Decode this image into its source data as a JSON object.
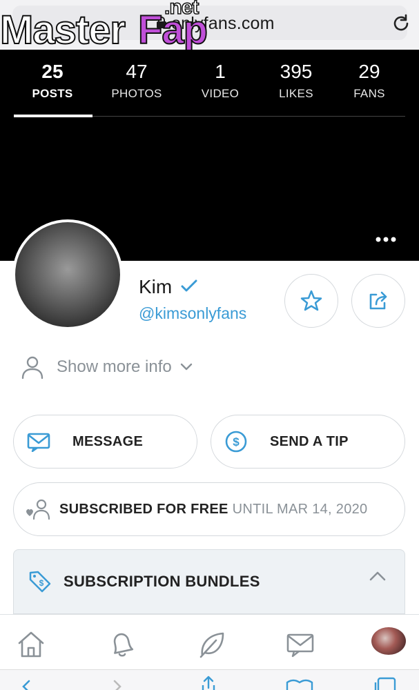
{
  "browser": {
    "url": "onlyfans.com",
    "watermark": {
      "main": "Master",
      "accent": "Fap",
      "suffix": ".net"
    }
  },
  "stats": [
    {
      "value": "25",
      "label": "POSTS",
      "active": true
    },
    {
      "value": "47",
      "label": "PHOTOS"
    },
    {
      "value": "1",
      "label": "VIDEO"
    },
    {
      "value": "395",
      "label": "LIKES"
    },
    {
      "value": "29",
      "label": "FANS"
    }
  ],
  "profile": {
    "name": "Kim",
    "handle": "@kimsonlyfans",
    "more_info_label": "Show more info"
  },
  "actions": {
    "message_label": "MESSAGE",
    "tip_label": "SEND A TIP",
    "subscribed_label": "SUBSCRIBED FOR FREE",
    "subscribed_until": "UNTIL MAR 14, 2020",
    "bundles_label": "SUBSCRIPTION BUNDLES"
  },
  "colors": {
    "accent": "#3a9bd5",
    "header_bg": "#000000",
    "muted": "#8a9197"
  },
  "icons": [
    "lock-icon",
    "reload-icon",
    "more-icon",
    "verified-icon",
    "star-icon",
    "share-icon",
    "user-icon",
    "chevron-down-icon",
    "mail-icon",
    "dollar-icon",
    "heart-user-icon",
    "tag-icon",
    "chevron-up-icon",
    "home-icon",
    "bell-icon",
    "leaf-icon"
  ]
}
